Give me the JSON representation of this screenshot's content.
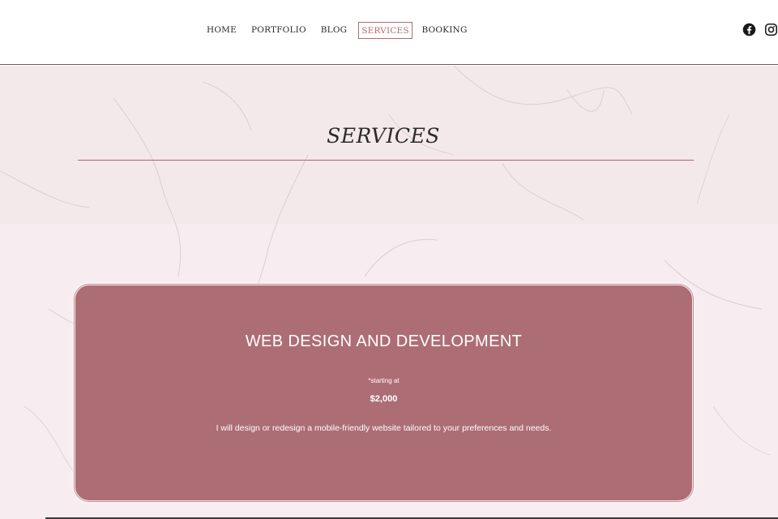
{
  "nav": {
    "items": [
      {
        "label": "HOME"
      },
      {
        "label": "PORTFOLIO"
      },
      {
        "label": "BLOG"
      },
      {
        "label": "SERVICES",
        "active": true
      },
      {
        "label": "BOOKING"
      }
    ],
    "active_color": "#b06b75"
  },
  "social": {
    "icons": [
      "facebook-icon",
      "instagram-icon"
    ]
  },
  "page": {
    "title": "SERVICES",
    "accent_color": "#a8646d"
  },
  "service_card": {
    "title": "WEB DESIGN AND DEVELOPMENT",
    "price_note": "*starting at",
    "price": "$2,000",
    "description": "I will design or redesign a mobile-friendly website tailored to your preferences and needs.",
    "background_color": "#ad6d74"
  }
}
